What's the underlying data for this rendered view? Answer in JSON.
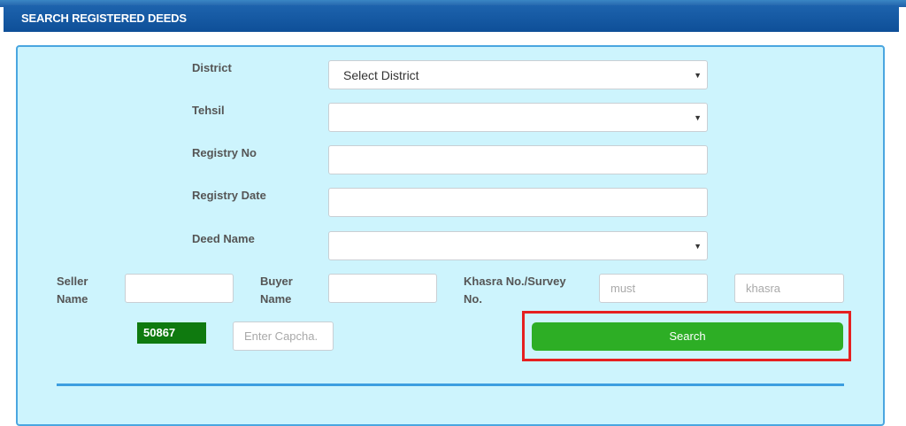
{
  "header": {
    "title": "SEARCH REGISTERED DEEDS"
  },
  "form": {
    "district": {
      "label": "District",
      "value": "Select District"
    },
    "tehsil": {
      "label": "Tehsil",
      "value": ""
    },
    "registry_no": {
      "label": "Registry No",
      "value": ""
    },
    "registry_date": {
      "label": "Registry Date",
      "value": ""
    },
    "deed_name": {
      "label": "Deed Name",
      "value": ""
    },
    "seller_name": {
      "label_line1": "Seller",
      "label_line2": "Name",
      "value": ""
    },
    "buyer_name": {
      "label_line1": "Buyer",
      "label_line2": "Name",
      "value": ""
    },
    "khasra": {
      "label_line1": "Khasra No./Survey",
      "label_line2": "No.",
      "field1_placeholder": "must",
      "field2_placeholder": "khasra"
    },
    "captcha": {
      "code": "50867",
      "placeholder": "Enter Capcha."
    },
    "search_label": "Search"
  },
  "icons": {
    "select_arrow": "dropdown-arrow-icon"
  },
  "colors": {
    "header_bg": "#0e4f98",
    "panel_bg": "#cdf4fd",
    "search_btn": "#2dae25",
    "captcha_bg": "#0f7a0f",
    "highlight": "#e52020"
  }
}
